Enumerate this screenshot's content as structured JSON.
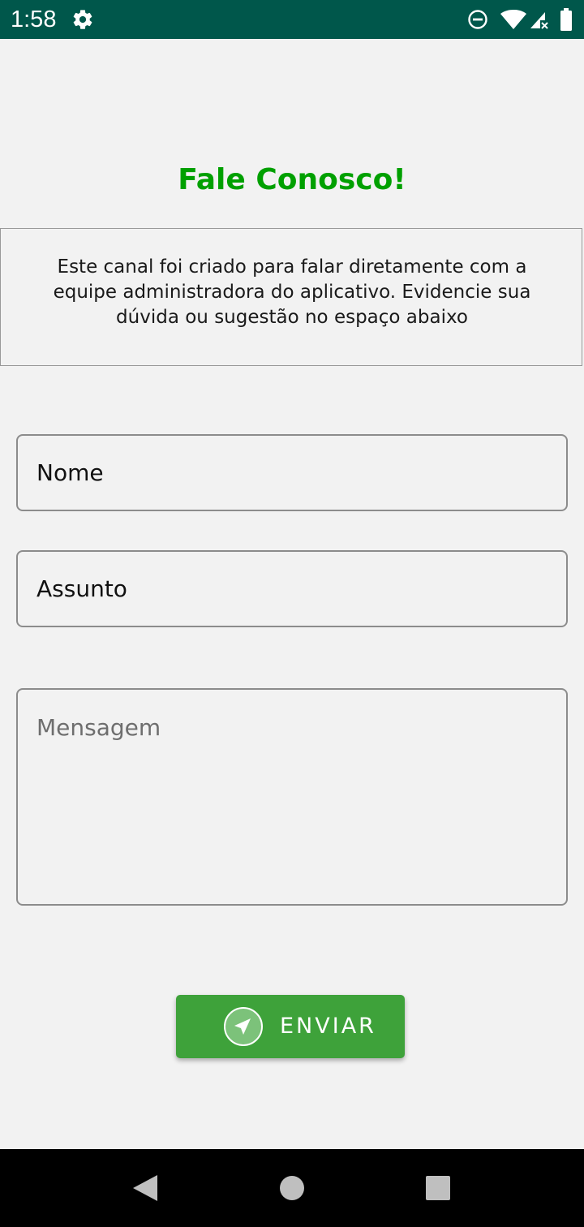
{
  "status_bar": {
    "time": "1:58",
    "icons": [
      "gear-icon",
      "do-not-disturb-icon",
      "wifi-icon",
      "signal-icon",
      "battery-icon"
    ],
    "background": "#00574b"
  },
  "page": {
    "title": "Fale Conosco!",
    "title_color": "#00a000",
    "info_text": "Este canal foi criado para falar diretamente com a equipe administradora do aplicativo. Evidencie sua dúvida ou sugestão no espaço abaixo"
  },
  "form": {
    "name_placeholder": "Nome",
    "subject_placeholder": "Assunto",
    "message_placeholder": "Mensagem",
    "send_label": "ENVIAR",
    "send_icon": "send-icon",
    "button_color": "#3ea23a"
  },
  "nav_bar": {
    "icons": [
      "back-icon",
      "home-icon",
      "recents-icon"
    ]
  }
}
